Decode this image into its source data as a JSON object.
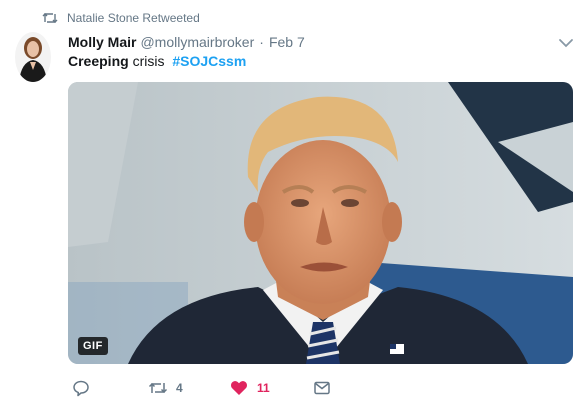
{
  "retweet_context": {
    "text": "Natalie Stone Retweeted",
    "icon": "retweet-icon"
  },
  "author": {
    "display_name": "Molly Mair",
    "screen_name": "@mollymairbroker",
    "separator": "·",
    "timestamp": "Feb 7"
  },
  "tweet": {
    "text_bold": "Creeping",
    "text_plain": "crisis",
    "hashtag": "#SOJCssm"
  },
  "media": {
    "badge": "GIF"
  },
  "actions": {
    "reply_count": "",
    "retweet_count": "4",
    "like_count": "11",
    "like_active": true
  },
  "colors": {
    "link": "#1da1f2",
    "muted": "#657786",
    "like": "#e0245e"
  }
}
